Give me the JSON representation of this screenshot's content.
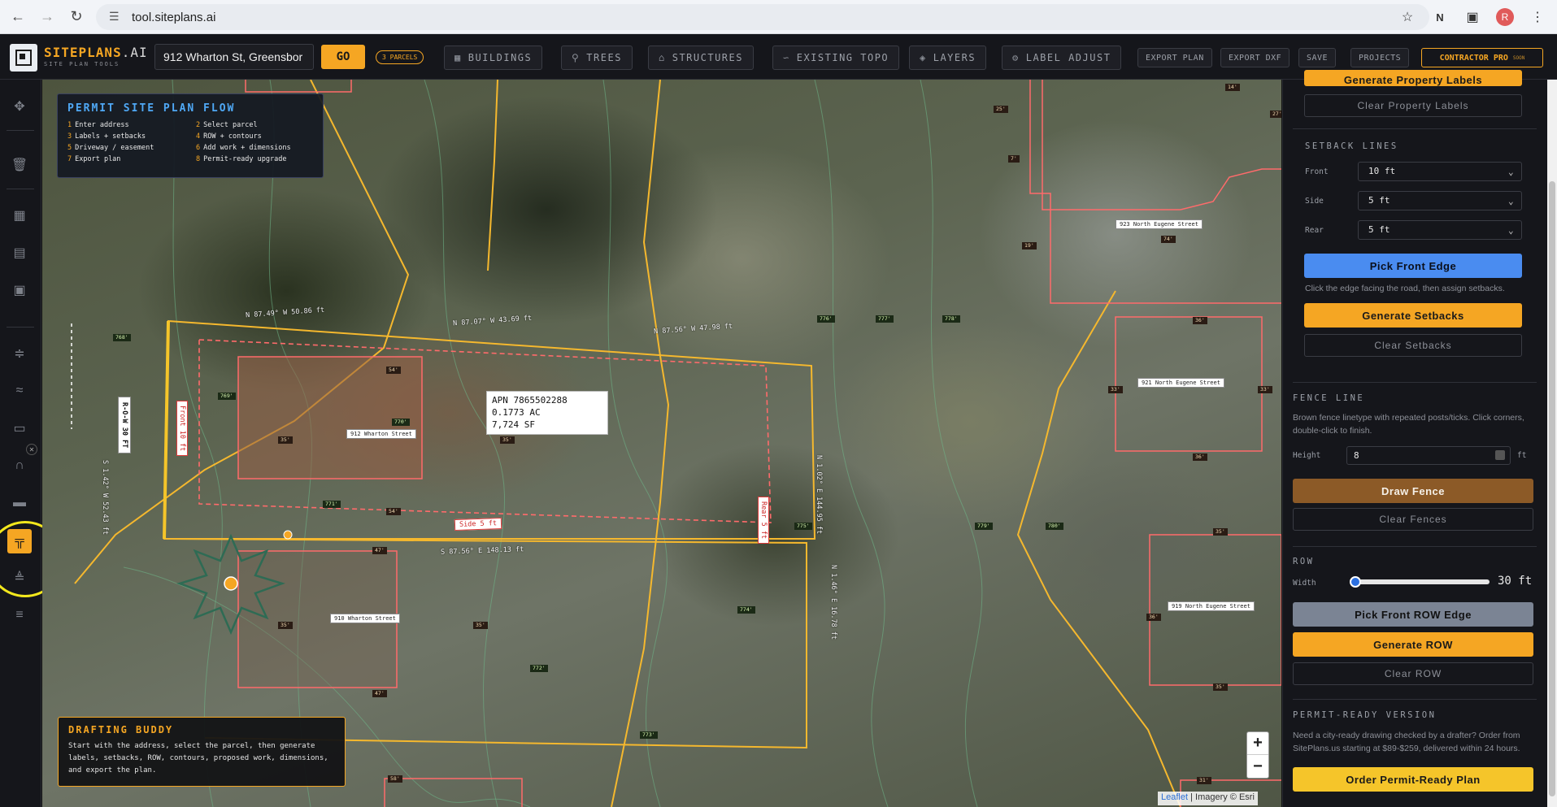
{
  "browser": {
    "url": "tool.siteplans.ai",
    "avatar_letter": "R"
  },
  "app": {
    "brand": "SITEPLANS",
    "brand_ai": ".AI",
    "brand_sub": "SITE PLAN TOOLS",
    "address": "912 Wharton St, Greensbor",
    "go_label": "GO",
    "parcels_badge": "3 PARCELS",
    "buttons": {
      "buildings": "BUILDINGS",
      "trees": "TREES",
      "structures": "STRUCTURES",
      "existing_topo": "EXISTING TOPO",
      "layers": "LAYERS",
      "label_adjust": "LABEL ADJUST",
      "export_plan": "EXPORT PLAN",
      "export_dxf": "EXPORT DXF",
      "save": "SAVE",
      "projects": "PROJECTS",
      "contractor": "CONTRACTOR PRO",
      "soon": "SOON"
    },
    "accent": "#f5a623"
  },
  "flow": {
    "title": "PERMIT SITE PLAN FLOW",
    "steps": [
      {
        "n": "1",
        "t": "Enter address"
      },
      {
        "n": "2",
        "t": "Select parcel"
      },
      {
        "n": "3",
        "t": "Labels + setbacks"
      },
      {
        "n": "4",
        "t": "ROW + contours"
      },
      {
        "n": "5",
        "t": "Driveway / easement"
      },
      {
        "n": "6",
        "t": "Add work + dimensions"
      },
      {
        "n": "7",
        "t": "Export plan"
      },
      {
        "n": "8",
        "t": "Permit-ready upgrade"
      }
    ]
  },
  "buddy": {
    "title": "DRAFTING BUDDY",
    "text": "Start with the address, select the parcel, then generate labels, setbacks, ROW, contours, proposed work, dimensions, and export the plan."
  },
  "map": {
    "apn": [
      "APN 7865502288",
      "0.1773 AC",
      "7,724 SF"
    ],
    "streets": {
      "s912": "912 Wharton Street",
      "s910": "910 Wharton Street",
      "s923": "923 North Eugene Street",
      "s921": "921 North Eugene Street",
      "s919": "919 North Eugene Street"
    },
    "bearings": {
      "b1": "N 87.49° W 50.86 ft",
      "b2": "N 87.07° W 43.69 ft",
      "b3": "N 87.56° W 47.98 ft",
      "b4": "S 87.56° E 148.13 ft",
      "b5": "N 1.02° E 144.95 ft",
      "b6": "S 1.42° W 52.43 ft",
      "b7": "N 1.46° E 16.78 ft"
    },
    "setbacks": {
      "front": "Front 10 ft",
      "side": "Side 5 ft",
      "rear": "Rear 5 ft"
    },
    "row_label": "R-O-W 30 FT",
    "elevations": [
      "768'",
      "769'",
      "770'",
      "771'",
      "772'",
      "773'",
      "774'",
      "775'",
      "776'",
      "777'",
      "778'",
      "779'",
      "780'"
    ],
    "dims": [
      "54'",
      "35'",
      "47'",
      "36'",
      "33'",
      "25'",
      "14'",
      "19'",
      "7'",
      "74'",
      "58'",
      "31'",
      "27'",
      "39'",
      "35'"
    ],
    "attribution_leaflet": "Leaflet",
    "attribution_rest": "| Imagery © Esri",
    "zoom_in": "+",
    "zoom_out": "−"
  },
  "panel": {
    "gen_labels": "Generate Property Labels",
    "clear_labels": "Clear Property Labels",
    "setback_title": "SETBACK LINES",
    "front_label": "Front",
    "front_val": "10 ft",
    "side_label": "Side",
    "side_val": "5 ft",
    "rear_label": "Rear",
    "rear_val": "5 ft",
    "pick_front": "Pick Front Edge",
    "pick_hint": "Click the edge facing the road, then assign setbacks.",
    "gen_setbacks": "Generate Setbacks",
    "clear_setbacks": "Clear Setbacks",
    "fence_title": "FENCE LINE",
    "fence_hint": "Brown fence linetype with repeated posts/ticks. Click corners, double-click to finish.",
    "height_label": "Height",
    "height_val": "8",
    "height_unit": "ft",
    "draw_fence": "Draw Fence",
    "clear_fences": "Clear Fences",
    "row_title": "ROW",
    "width_label": "Width",
    "row_width": "30 ft",
    "row_fraction": 0.0,
    "pick_row": "Pick Front ROW Edge",
    "gen_row": "Generate ROW",
    "clear_row": "Clear ROW",
    "permit_title": "PERMIT-READY VERSION",
    "permit_hint": "Need a city-ready drawing checked by a drafter? Order from SitePlans.us starting at $89-$259, delivered within 24 hours.",
    "order": "Order Permit-Ready Plan"
  }
}
